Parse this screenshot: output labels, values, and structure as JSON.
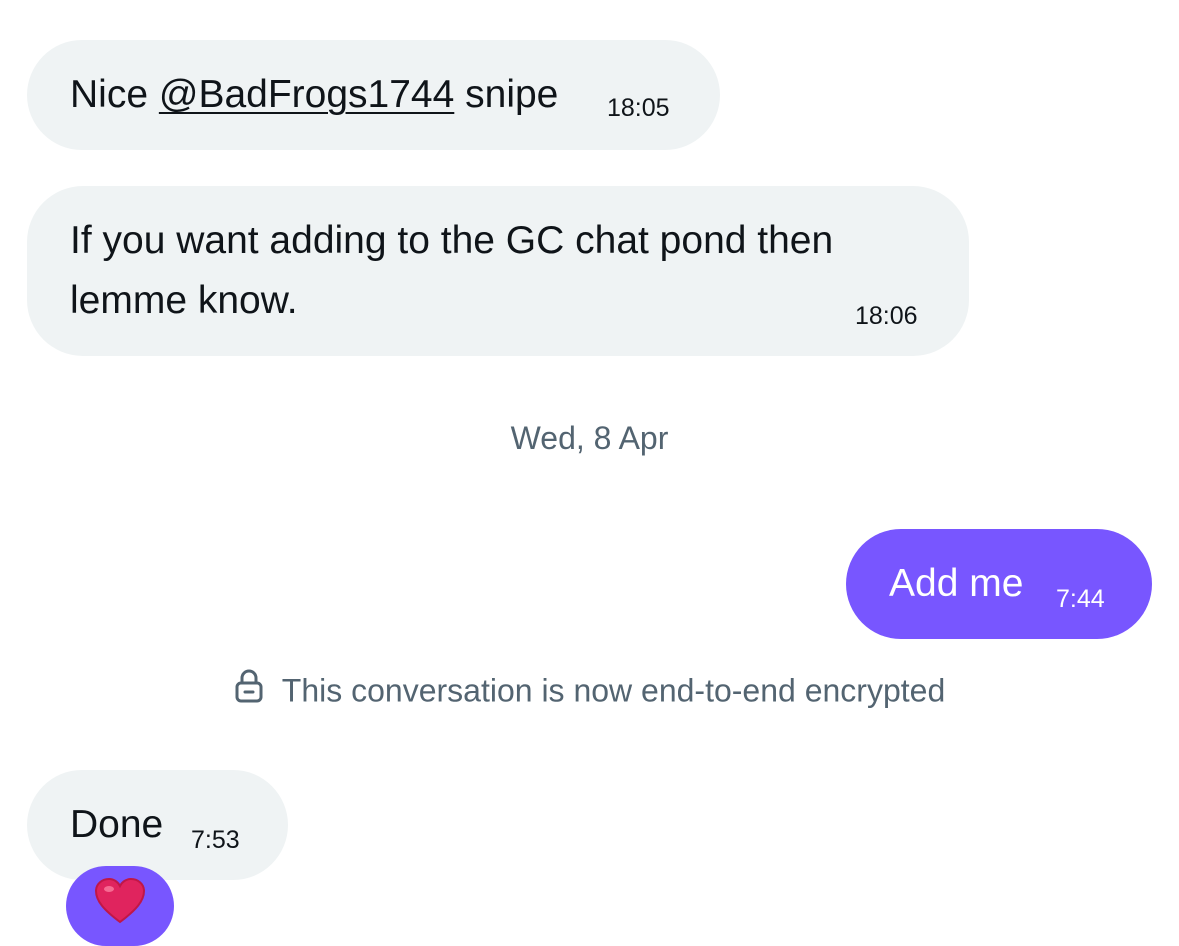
{
  "messages": [
    {
      "prefix": "Nice ",
      "mention": "@BadFrogs1744",
      "suffix": " snipe",
      "time": "18:05"
    },
    {
      "line1": "If you want adding to the GC chat pond then",
      "line2": "lemme know.",
      "time": "18:06"
    },
    {
      "text": "Add me",
      "time": "7:44"
    },
    {
      "text": "Done",
      "time": "7:53"
    }
  ],
  "date_separator": "Wed, 8 Apr",
  "encryption_notice": "This conversation is now end-to-end encrypted",
  "reaction": {
    "emoji_name": "heart-icon",
    "color": "#e0245e"
  },
  "colors": {
    "sent_bubble": "#7856ff",
    "received_bubble": "#eff3f4",
    "muted_text": "#536471"
  }
}
